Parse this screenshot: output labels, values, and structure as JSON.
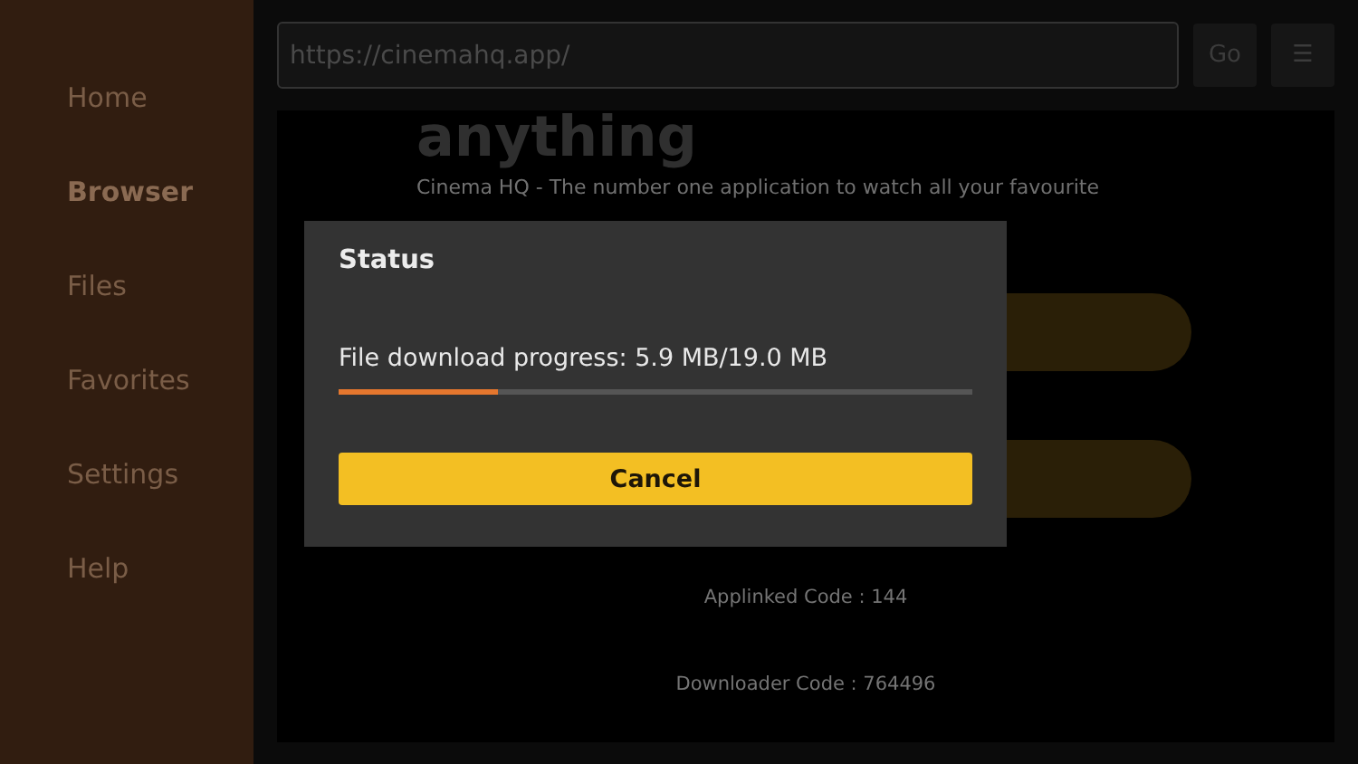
{
  "sidebar": {
    "items": [
      {
        "label": "Home",
        "selected": false
      },
      {
        "label": "Browser",
        "selected": true
      },
      {
        "label": "Files",
        "selected": false
      },
      {
        "label": "Favorites",
        "selected": false
      },
      {
        "label": "Settings",
        "selected": false
      },
      {
        "label": "Help",
        "selected": false
      }
    ]
  },
  "address_bar": {
    "value": "https://cinemahq.app/",
    "go_button": "Go",
    "menu_button": "☰"
  },
  "page": {
    "heading": "anything",
    "tagline": "Cinema HQ - The number one application to watch all your favourite",
    "applinked_code": "Applinked Code : 144",
    "downloader_code": "Downloader Code : 764496"
  },
  "dialog": {
    "title": "Status",
    "message": "File download progress: 5.9 MB/19.0 MB",
    "progress": {
      "level": 0.25
    },
    "button": "Cancel"
  }
}
